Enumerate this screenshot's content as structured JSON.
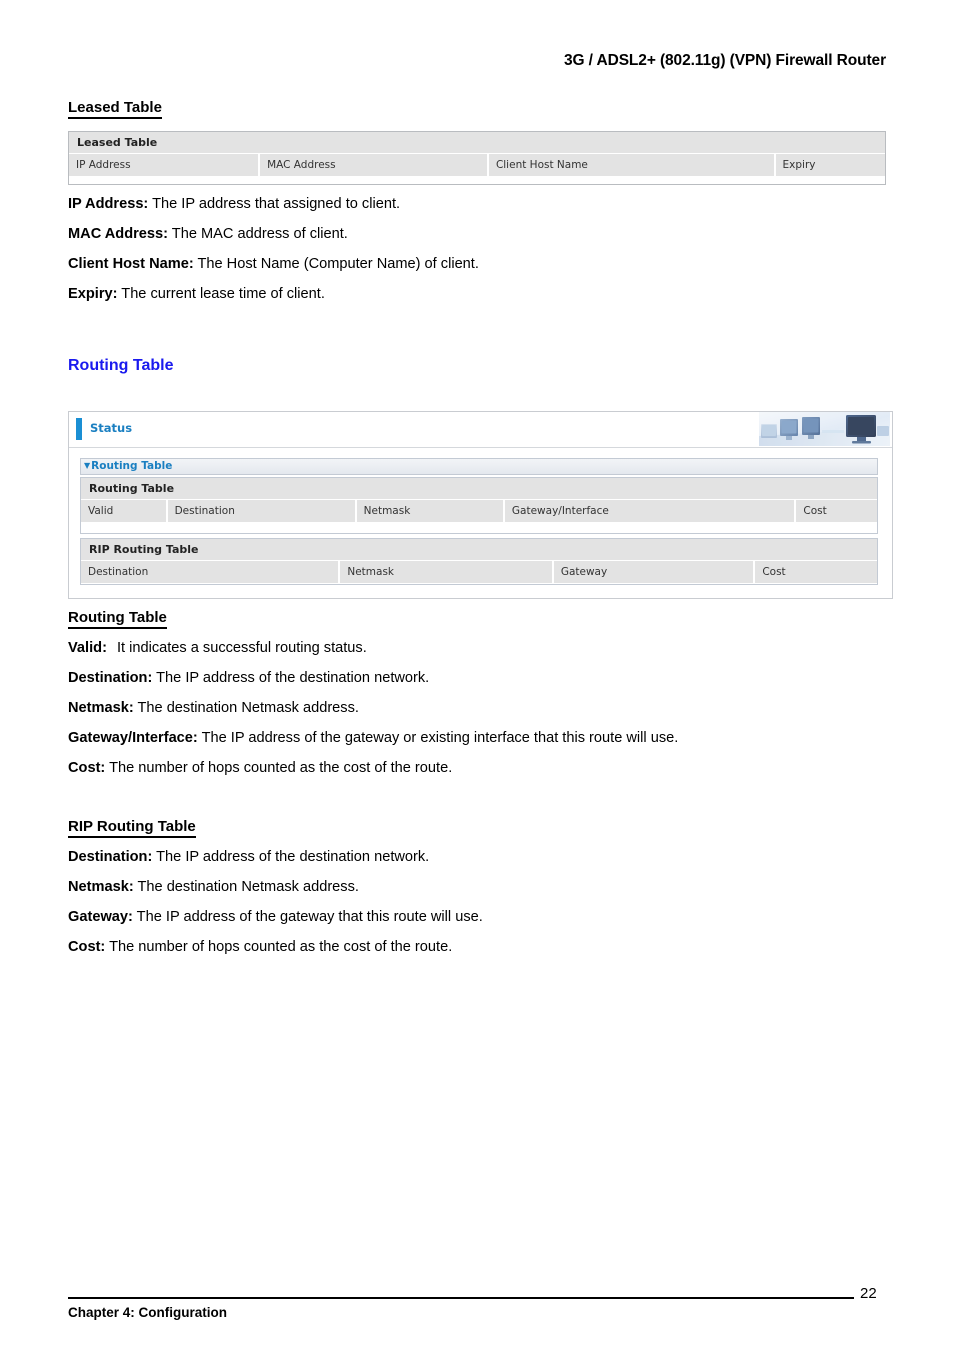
{
  "document": {
    "running_header": "3G / ADSL2+ (802.11g) (VPN) Firewall Router",
    "footer_chapter": "Chapter 4: Configuration",
    "page_number": "22"
  },
  "leased_section": {
    "heading": "Leased Table ",
    "table": {
      "caption": "Leased Table",
      "columns": [
        "IP Address",
        "MAC Address",
        "Client Host Name",
        "Expiry"
      ]
    },
    "definitions": [
      {
        "term": "IP Address:",
        "desc": " The IP address that assigned to client."
      },
      {
        "term": "MAC Address:",
        "desc": " The MAC address of client."
      },
      {
        "term": "Client Host Name:",
        "desc": " The Host Name (Computer Name) of client."
      },
      {
        "term": "Expiry:",
        "desc": " The current lease time of client."
      }
    ]
  },
  "routing_section": {
    "heading": "Routing Table",
    "heading_color": "#1a1aee",
    "panel": {
      "status_label": "Status",
      "status_accent_color": "#1a8fd4",
      "banner_icon": "computer-monitors-photo",
      "collapse_bar": {
        "icon": "triangle-down-icon",
        "label": "Routing Table"
      },
      "routing_table": {
        "caption": "Routing Table",
        "columns": [
          "Valid",
          "Destination",
          "Netmask",
          "Gateway/Interface",
          "Cost"
        ]
      },
      "rip_routing_table": {
        "caption": "RIP Routing Table",
        "columns": [
          "Destination",
          "Netmask",
          "Gateway",
          "Cost"
        ]
      }
    },
    "routing_heading": "Routing Table",
    "routing_definitions": [
      {
        "term": "Valid:",
        "desc": "It indicates a successful routing status."
      },
      {
        "term": "Destination:",
        "desc": " The IP address of the destination network."
      },
      {
        "term": "Netmask:",
        "desc": " The destination Netmask address."
      },
      {
        "term": "Gateway/Interface:",
        "desc": " The IP address of the gateway or existing interface that this route will use."
      },
      {
        "term": "Cost:",
        "desc": " The number of hops counted as the cost of the route."
      }
    ],
    "rip_heading": "RIP Routing Table",
    "rip_definitions": [
      {
        "term": "Destination:",
        "desc": " The IP address of the destination network."
      },
      {
        "term": "Netmask:",
        "desc": " The destination Netmask address."
      },
      {
        "term": "Gateway:",
        "desc": " The IP address of the gateway that this route will use."
      },
      {
        "term": "Cost:",
        "desc": " The number of hops counted as the cost of the route."
      }
    ]
  }
}
